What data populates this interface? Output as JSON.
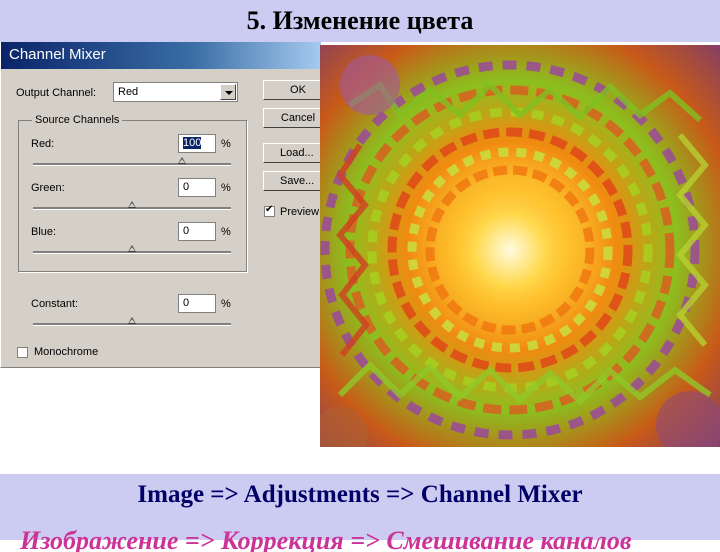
{
  "slide": {
    "title": "5. Изменение цвета",
    "caption": "Image => Adjustments => Channel Mixer",
    "cut_line": "Изображение => Коррекция => Смешивание каналов"
  },
  "dialog": {
    "title": "Channel Mixer",
    "output_channel_label": "Output Channel:",
    "output_channel_value": "Red",
    "source_group_label": "Source Channels",
    "channels": [
      {
        "label": "Red:",
        "value": "100",
        "unit": "%",
        "slider_level": 0.75
      },
      {
        "label": "Green:",
        "value": "0",
        "unit": "%",
        "slider_level": 0.5
      },
      {
        "label": "Blue:",
        "value": "0",
        "unit": "%",
        "slider_level": 0.5
      }
    ],
    "constant": {
      "label": "Constant:",
      "value": "0",
      "unit": "%",
      "slider_level": 0.5
    },
    "monochrome_label": "Monochrome",
    "monochrome_checked": false,
    "buttons": {
      "ok": "OK",
      "cancel": "Cancel",
      "load": "Load...",
      "save": "Save..."
    },
    "preview_label": "Preview",
    "preview_checked": true
  },
  "colors": {
    "band": "#ccccf2",
    "title_bar": "#0a246a",
    "dialog_face": "#d4d0c8"
  }
}
